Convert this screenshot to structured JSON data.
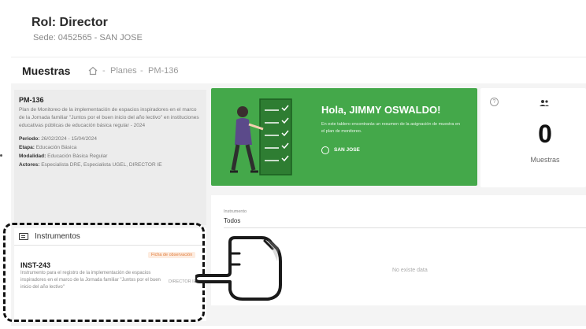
{
  "header": {
    "role_title": "Rol: Director",
    "sede": "Sede: 0452565 - SAN JOSE"
  },
  "breadcrumb": {
    "title": "Muestras",
    "separator": "-",
    "planes": "Planes",
    "code": "PM-136"
  },
  "plan": {
    "code": "PM-136",
    "description": "Plan de Monitoreo de la implementación de espacios inspiradores en el marco de la Jornada familiar \"Juntos por el buen inicio del año lectivo\" en instituciones educativas públicas de educación básica regular - 2024",
    "periodo_label": "Periodo:",
    "periodo_value": "26/02/2024 - 15/04/2024",
    "etapa_label": "Etapa:",
    "etapa_value": "Educación Básica",
    "modalidad_label": "Modalidad:",
    "modalidad_value": "Educación Básica Regular",
    "actores_label": "Actores:",
    "actores_value": "Especialista DRE, Especialista UGEL, DIRECTOR IE"
  },
  "instruments": {
    "title": "Instrumentos",
    "items": [
      {
        "badge": "Ficha de observación",
        "code": "INST-243",
        "description": "Instrumento para el registro de la implementación de espacios inspiradores en el marco de la Jornada familiar \"Juntos por el buen inicio del año lectivo\"",
        "role": "DIRECTOR IE"
      }
    ]
  },
  "welcome": {
    "greeting": "Hola, JIMMY OSWALDO!",
    "message": "En este tablero encontrarás un resumen de la asignación de muestra en el plan de monitoreo.",
    "place": "SAN JOSE",
    "accent_color": "#44a84a"
  },
  "stats": {
    "value": "0",
    "label": "Muestras"
  },
  "filter": {
    "label": "Instrumento",
    "value": "Todos"
  },
  "table": {
    "empty_text": "No existe data"
  },
  "icons": [
    "home-icon",
    "instruments-icon",
    "place-icon",
    "help-icon",
    "group-icon",
    "pointing-hand-icon"
  ]
}
